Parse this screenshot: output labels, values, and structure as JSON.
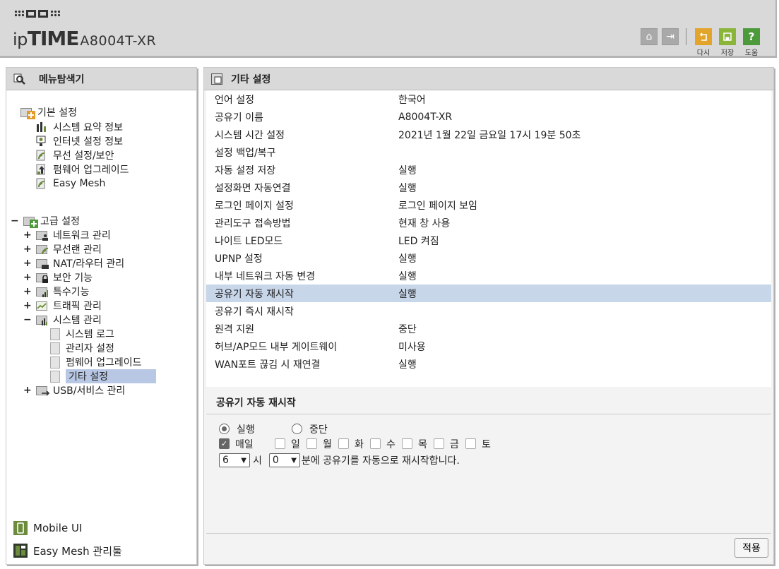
{
  "header": {
    "brand_prefix": "ip",
    "brand_name": "TIME",
    "model": "A8004T-XR",
    "home_label": "⌂",
    "logout_label": "⇥",
    "retry_label": "다시",
    "save_label": "저장",
    "help_label": "도움",
    "help_glyph": "?",
    "colors": {
      "retry": "#e2a42a",
      "save": "#8ab43a",
      "help": "#4c9a3a"
    }
  },
  "sidebar": {
    "title": "메뉴탐색기",
    "basic": {
      "label": "기본 설정",
      "items": [
        "시스템 요약 정보",
        "인터넷 설정 정보",
        "무선 설정/보안",
        "펌웨어 업그레이드",
        "Easy Mesh"
      ]
    },
    "advanced": {
      "toggle": "−",
      "label": "고급 설정",
      "groups": [
        {
          "toggle": "+",
          "label": "네트워크 관리"
        },
        {
          "toggle": "+",
          "label": "무선랜 관리"
        },
        {
          "toggle": "+",
          "label": "NAT/라우터 관리"
        },
        {
          "toggle": "+",
          "label": "보안 기능"
        },
        {
          "toggle": "+",
          "label": "특수기능"
        },
        {
          "toggle": "+",
          "label": "트래픽 관리"
        },
        {
          "toggle": "−",
          "label": "시스템 관리"
        }
      ],
      "system_items": [
        "시스템 로그",
        "관리자 설정",
        "펌웨어 업그레이드",
        "기타 설정"
      ],
      "usb": {
        "toggle": "+",
        "label": "USB/서비스 관리"
      }
    },
    "mobile_ui": "Mobile UI",
    "mesh_tool": "Easy Mesh 관리툴"
  },
  "main": {
    "title": "기타 설정",
    "settings": [
      {
        "key": "언어 설정",
        "value": "한국어"
      },
      {
        "key": "공유기 이름",
        "value": "A8004T-XR"
      },
      {
        "key": "시스템 시간 설정",
        "value": "2021년 1월 22일 금요일 17시 19분 50초"
      },
      {
        "key": "설정 백업/복구",
        "value": ""
      },
      {
        "key": "자동 설정 저장",
        "value": "실행"
      },
      {
        "key": "설정화면 자동연결",
        "value": "실행"
      },
      {
        "key": "로그인 페이지 설정",
        "value": "로그인 페이지 보임"
      },
      {
        "key": "관리도구 접속방법",
        "value": "현재 창 사용"
      },
      {
        "key": "나이트 LED모드",
        "value": "LED 켜짐"
      },
      {
        "key": "UPNP 설정",
        "value": "실행"
      },
      {
        "key": "내부 네트워크 자동 변경",
        "value": "실행"
      },
      {
        "key": "공유기 자동 재시작",
        "value": "실행"
      },
      {
        "key": "공유기 즉시 재시작",
        "value": ""
      },
      {
        "key": "원격 지원",
        "value": "중단"
      },
      {
        "key": "허브/AP모드 내부 게이트웨이",
        "value": "미사용"
      },
      {
        "key": "WAN포트 끊김 시 재연결",
        "value": "실행"
      }
    ],
    "restart": {
      "title": "공유기 자동 재시작",
      "run_label": "실행",
      "stop_label": "중단",
      "daily_label": "매일",
      "days": [
        "일",
        "월",
        "화",
        "수",
        "목",
        "금",
        "토"
      ],
      "hour_value": "6",
      "hour_unit": "시",
      "minute_value": "0",
      "suffix": "분에 공유기를 자동으로 재시작합니다."
    },
    "apply_label": "적용"
  }
}
